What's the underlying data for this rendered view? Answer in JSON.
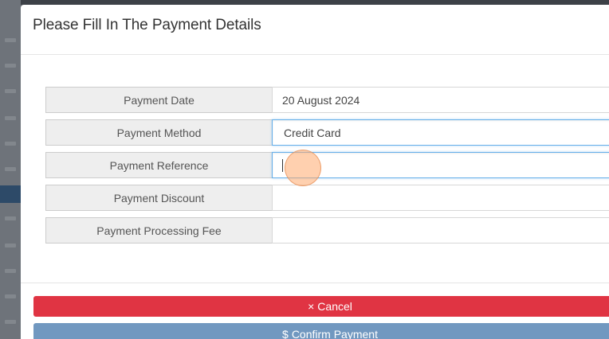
{
  "modal": {
    "title": "Please Fill In The Payment Details"
  },
  "fields": [
    {
      "label": "Payment Date",
      "value": "20 August 2024",
      "editable": false
    },
    {
      "label": "Payment Method",
      "value": "Credit Card",
      "editable": true
    },
    {
      "label": "Payment Reference",
      "value": "",
      "editable": true
    },
    {
      "label": "Payment Discount",
      "value": "",
      "editable": true
    },
    {
      "label": "Payment Processing Fee",
      "value": "",
      "editable": true
    }
  ],
  "buttons": {
    "cancel_icon": "×",
    "cancel_label": "Cancel",
    "confirm_icon": "$",
    "confirm_label": "Confirm Payment"
  },
  "colors": {
    "cancel": "#e03443",
    "confirm": "#7198c0",
    "focus_border": "#66afe9"
  }
}
